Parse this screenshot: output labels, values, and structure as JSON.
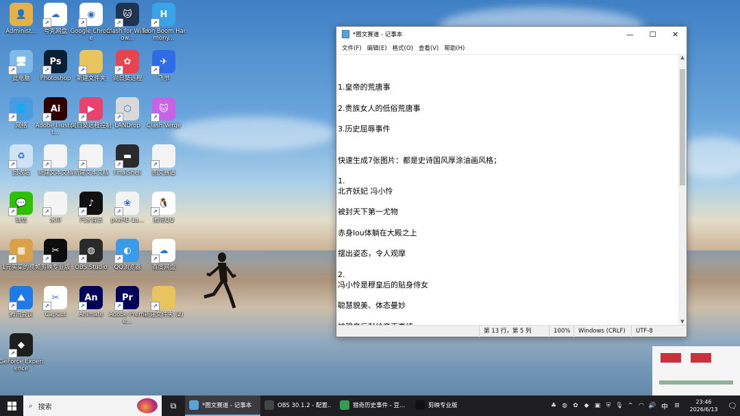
{
  "desktop_icons": [
    {
      "label": "Administ...",
      "icon": "user-folder-icon",
      "color": "#e7b14a",
      "glyph": "👤"
    },
    {
      "label": "夸克网盘",
      "icon": "quark-drive-icon",
      "color": "#ffffff",
      "glyph": "☁"
    },
    {
      "label": "Google Chrome",
      "icon": "chrome-icon",
      "color": "#ffffff",
      "glyph": "◉"
    },
    {
      "label": "Clash for Window...",
      "icon": "clash-icon",
      "color": "#20344f",
      "glyph": "🐱"
    },
    {
      "label": "Toon Boom Harmony...",
      "icon": "toon-boom-icon",
      "color": "#3aa3e8",
      "glyph": "H"
    },
    {
      "label": "此电脑",
      "icon": "this-pc-icon",
      "color": "#7fb9ea",
      "glyph": "🖥"
    },
    {
      "label": "Photoshop",
      "icon": "photoshop-icon",
      "color": "#0a1f33",
      "glyph": "Ps"
    },
    {
      "label": "新建文件夹",
      "icon": "folder-icon",
      "color": "#e9c35e",
      "glyph": ""
    },
    {
      "label": "向日葵远程",
      "icon": "sunlogin-icon",
      "color": "#e6454f",
      "glyph": "✿"
    },
    {
      "label": "飞书",
      "icon": "feishu-icon",
      "color": "#2e6be6",
      "glyph": "✈"
    },
    {
      "label": "网络",
      "icon": "network-icon",
      "color": "#4b9be0",
      "glyph": "🌐"
    },
    {
      "label": "Adobe Illustrat...",
      "icon": "illustrator-icon",
      "color": "#330000",
      "glyph": "Ai"
    },
    {
      "label": "向日葵远程控制",
      "icon": "sunlogin-control-icon",
      "color": "#e8436f",
      "glyph": "▶"
    },
    {
      "label": "LANDrop",
      "icon": "landrop-icon",
      "color": "#d9d9d9",
      "glyph": "⬡"
    },
    {
      "label": "Clash Verge",
      "icon": "clash-verge-icon",
      "color": "#c761e6",
      "glyph": "🐱"
    },
    {
      "label": "回收站",
      "icon": "recycle-bin-icon",
      "color": "#cfe3f5",
      "glyph": "♻"
    },
    {
      "label": "新建文本文档",
      "icon": "text-file-icon",
      "color": "#f4f4f4",
      "glyph": ""
    },
    {
      "label": "新建文本文档",
      "icon": "text-file-icon",
      "color": "#f4f4f4",
      "glyph": ""
    },
    {
      "label": "FinalShell",
      "icon": "finalshell-icon",
      "color": "#2b2b2b",
      "glyph": "▬"
    },
    {
      "label": "图文赛道",
      "icon": "text-file-icon",
      "color": "#f4f4f4",
      "glyph": ""
    },
    {
      "label": "微信",
      "icon": "wechat-icon",
      "color": "#2dc100",
      "glyph": "💬"
    },
    {
      "label": "水印",
      "icon": "text-file-icon",
      "color": "#f4f4f4",
      "glyph": ""
    },
    {
      "label": "汽水音乐",
      "icon": "qishui-music-icon",
      "color": "#111111",
      "glyph": "♪"
    },
    {
      "label": "pxzHE-1a...",
      "icon": "image-file-icon",
      "color": "#f3f3f3",
      "glyph": "❀"
    },
    {
      "label": "腾讯QQ",
      "icon": "qq-icon",
      "color": "#ffffff",
      "glyph": "🐧"
    },
    {
      "label": "1元买菜的视频",
      "icon": "video-file-icon",
      "color": "#d9a24a",
      "glyph": "▦"
    },
    {
      "label": "剪映专业版",
      "icon": "capcut-icon",
      "color": "#0d0d0d",
      "glyph": "✂"
    },
    {
      "label": "OBS Studio",
      "icon": "obs-icon",
      "color": "#2a2a2a",
      "glyph": "◍"
    },
    {
      "label": "QQ浏览器",
      "icon": "qq-browser-icon",
      "color": "#3a9be8",
      "glyph": "◐"
    },
    {
      "label": "百度网盘",
      "icon": "baidu-netdisk-icon",
      "color": "#ffffff",
      "glyph": "☁"
    },
    {
      "label": "腾讯会议",
      "icon": "tencent-meeting-icon",
      "color": "#1f7ae6",
      "glyph": "⛰"
    },
    {
      "label": "CapCut",
      "icon": "capcut-intl-icon",
      "color": "#ffffff",
      "glyph": "✂"
    },
    {
      "label": "Animate",
      "icon": "animate-icon",
      "color": "#00005b",
      "glyph": "An"
    },
    {
      "label": "Adobe Premie...",
      "icon": "premiere-icon",
      "color": "#00005b",
      "glyph": "Pr"
    },
    {
      "label": "新建文件夹 (2)",
      "icon": "folder-icon",
      "color": "#e9c35e",
      "glyph": ""
    },
    {
      "label": "GeForce Experience",
      "icon": "geforce-icon",
      "color": "#1f1f1f",
      "glyph": "◆"
    }
  ],
  "notepad": {
    "title": "*图文赛道 - 记事本",
    "controls": {
      "minimize": "—",
      "maximize": "☐",
      "close": "✕"
    },
    "menu": [
      "文件(F)",
      "编辑(E)",
      "格式(O)",
      "查看(V)",
      "帮助(H)"
    ],
    "lines": [
      "",
      "1.皇帝的荒唐事",
      "",
      "2.贵族女人的低俗荒唐事",
      "",
      "3.历史屈辱事件",
      "",
      "",
      "快速生成7张图片：都是史诗国风厚涂油画风格；",
      "",
      "1.",
      "北齐妖妃 冯小怜",
      "",
      "被封天下第一尤物",
      "",
      "赤身lou体躺在大殿之上",
      "",
      "摆出姿态，令人观摩",
      "",
      "2.",
      "冯小怜是穆皇后的贴身侍女",
      "",
      "聪慧貌美、体态曼妙",
      "",
      "被穆皇后献给齐王高纬"
    ],
    "status": {
      "position": "第 13 行，第 5 列",
      "zoom": "100%",
      "line_ending": "Windows (CRLF)",
      "encoding": "UTF-8"
    }
  },
  "taskbar": {
    "search_placeholder": "搜索",
    "apps": [
      {
        "label": "*图文赛道 - 记事本",
        "icon": "notepad-icon",
        "color": "#5aa3d8",
        "active": true
      },
      {
        "label": "OBS 30.1.2 - 配置...",
        "icon": "obs-icon",
        "color": "#444444",
        "active": false
      },
      {
        "label": "猎奇历史事件 - 豆...",
        "icon": "chrome-icon",
        "color": "#2f9e4e",
        "active": false
      },
      {
        "label": "剪映专业版",
        "icon": "capcut-icon",
        "color": "#111111",
        "active": false
      }
    ],
    "ime": "中",
    "time": "23:46",
    "date": "2026/6/13"
  }
}
